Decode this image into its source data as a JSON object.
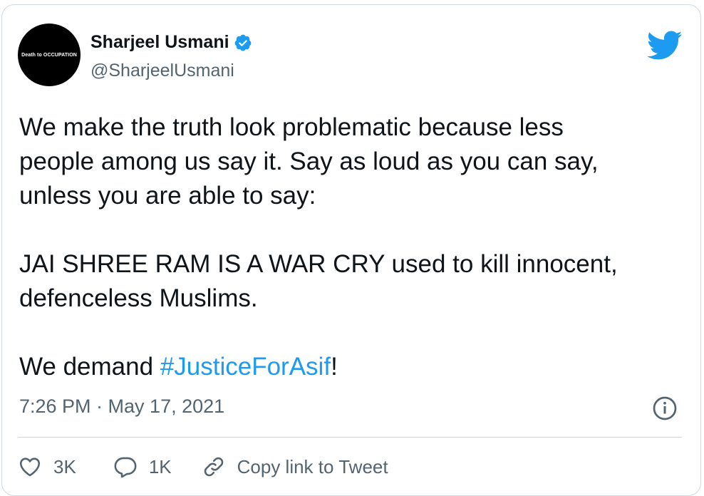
{
  "author": {
    "avatar_text": "Death to OCCUPATION",
    "name": "Sharjeel Usmani",
    "handle": "@SharjeelUsmani",
    "verified": true
  },
  "tweet": {
    "lines": [
      "We make the truth look problematic because less",
      "people among us say it. Say as loud as you can say,",
      "unless you are able to say:",
      "",
      "JAI SHREE RAM IS A WAR CRY used to kill innocent,",
      "defenceless Muslims.",
      "",
      "We demand "
    ],
    "hashtag": "#JusticeForAsif",
    "after_hashtag": "!"
  },
  "meta": {
    "timestamp": "7:26 PM · May 17, 2021"
  },
  "actions": {
    "like_count": "3K",
    "reply_count": "1K",
    "copy_label": "Copy link to Tweet"
  },
  "colors": {
    "accent": "#1d9bf0",
    "secondary_text": "#536471",
    "primary_text": "#0f1419",
    "border": "#cfd9de"
  },
  "icons": [
    "verified-badge-icon",
    "twitter-bird-icon",
    "info-icon",
    "heart-icon",
    "reply-bubble-icon",
    "link-icon"
  ]
}
